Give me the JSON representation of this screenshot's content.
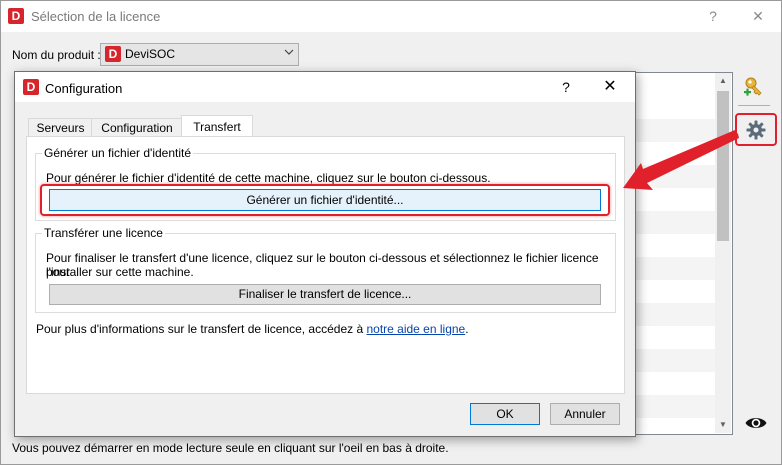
{
  "window": {
    "logo_letter": "D",
    "title": "Sélection de la licence",
    "help": "?",
    "close": "✕"
  },
  "product": {
    "label": "Nom du produit :",
    "logo_letter": "D",
    "value": "DeviSOC"
  },
  "bottom_hint": "Vous pouvez démarrer en mode lecture seule en cliquant sur l'oeil en bas à droite.",
  "dialog": {
    "logo_letter": "D",
    "title": "Configuration",
    "help": "?",
    "close": "✕",
    "tabs": [
      {
        "label": "Serveurs"
      },
      {
        "label": "Configuration"
      },
      {
        "label": "Transfert"
      }
    ],
    "generate": {
      "legend": "Générer un fichier d'identité",
      "text": "Pour générer le fichier d'identité de cette machine, cliquez sur le bouton ci-dessous.",
      "button": "Générer un fichier d'identité..."
    },
    "transfer": {
      "legend": "Transférer une licence",
      "text1": "Pour finaliser le transfert d'une licence, cliquez sur le bouton ci-dessous et sélectionnez le fichier licence pour",
      "text2": "l'installer sur cette machine.",
      "button": "Finaliser le transfert de licence..."
    },
    "info_prefix": "Pour plus d'informations sur le transfert de licence, accédez à ",
    "info_link": "notre aide en ligne",
    "info_suffix": ".",
    "ok": "OK",
    "cancel": "Annuler"
  },
  "colors": {
    "brand_red": "#d6262b",
    "highlight_red": "#e0202a",
    "link_blue": "#0645ad",
    "focus_blue": "#0078d7"
  }
}
